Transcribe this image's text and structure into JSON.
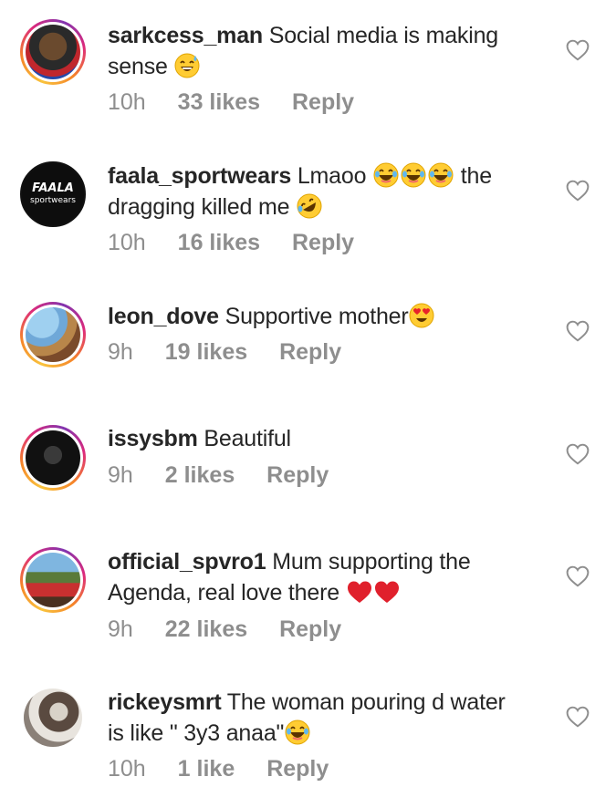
{
  "comments": [
    {
      "username": "sarkcess_man",
      "line1": "Social media is making",
      "line2": "sense",
      "likes": "33 likes",
      "time": "10h",
      "reply": "Reply"
    },
    {
      "username": "faala_sportwears",
      "line1": "Lmaoo",
      "line1b": "the",
      "line2": "dragging killed me",
      "likes": "16 likes",
      "time": "10h",
      "reply": "Reply",
      "avatar_text1": "FAALA",
      "avatar_text2": "sportwears"
    },
    {
      "username": "leon_dove",
      "line1": "Supportive mother",
      "likes": "19 likes",
      "time": "9h",
      "reply": "Reply"
    },
    {
      "username": "issysbm",
      "line1": "Beautiful",
      "likes": "2 likes",
      "time": "9h",
      "reply": "Reply"
    },
    {
      "username": "official_spvro1",
      "line1": "Mum supporting the",
      "line2": "Agenda, real love there",
      "likes": "22 likes",
      "time": "9h",
      "reply": "Reply"
    },
    {
      "username": "rickeysmrt",
      "line1": "The woman pouring d water",
      "line2": "is like \" 3y3 anaa\"",
      "likes": "1 like",
      "time": "10h",
      "reply": "Reply"
    }
  ],
  "colors": {
    "text": "#262626",
    "meta": "#8e8e8e",
    "heart_outline": "#8e8e8e",
    "ring": "#dd2a7b"
  }
}
